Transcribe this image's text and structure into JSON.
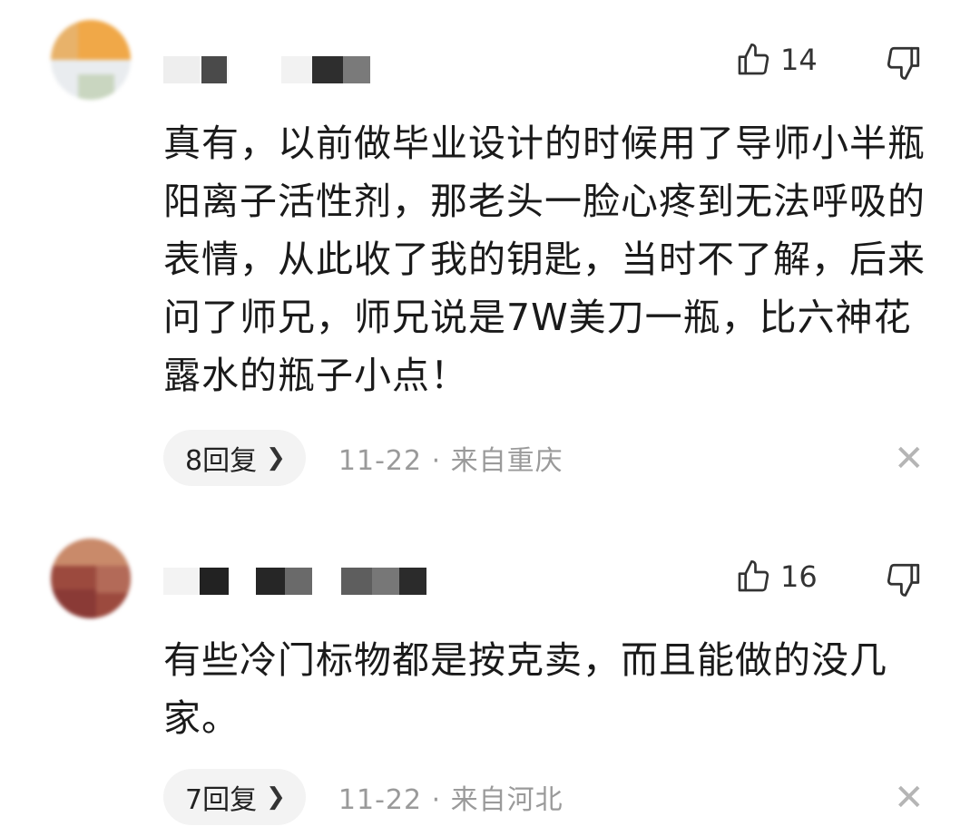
{
  "comments": [
    {
      "likes": "14",
      "text": "真有，以前做毕业设计的时候用了导师小半瓶阳离子活性剂，那老头一脸心疼到无法呼吸的表情，从此收了我的钥匙，当时不了解，后来问了师兄，师兄说是7W美刀一瓶，比六神花露水的瓶子小点！",
      "reply_label": "8回复",
      "meta": "11-22 · 来自重庆",
      "icons": {
        "like": "thumbs-up-icon",
        "dislike": "thumbs-down-icon",
        "close": "close-icon",
        "chevron": "chevron-right-icon"
      }
    },
    {
      "likes": "16",
      "text": "有些冷门标物都是按克卖，而且能做的没几家。",
      "reply_label": "7回复",
      "meta": "11-22 · 来自河北",
      "icons": {
        "like": "thumbs-up-icon",
        "dislike": "thumbs-down-icon",
        "close": "close-icon",
        "chevron": "chevron-right-icon"
      }
    }
  ],
  "colors": {
    "pill_bg": "#f3f3f3",
    "meta": "#9a9a9a",
    "close": "#b5b5b5"
  }
}
